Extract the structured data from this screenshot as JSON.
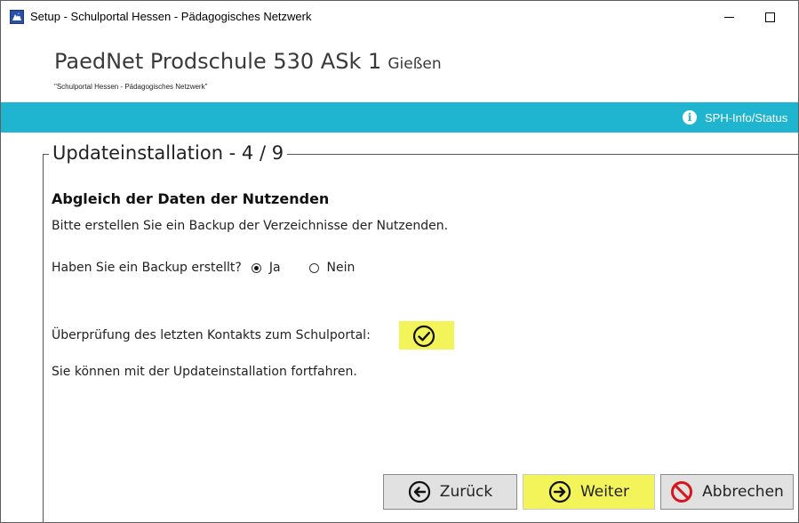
{
  "window": {
    "title": "Setup - Schulportal Hessen - Pädagogisches Netzwerk",
    "minimize_icon": "minimize-icon",
    "maximize_icon": "maximize-icon"
  },
  "header": {
    "title": "PaedNet Prodschule 530 ASk 1",
    "location": "Gießen",
    "subtitle": "\"Schulportal Hessen - Pädagogisches Netzwerk\""
  },
  "infobar": {
    "link_label": "SPH-Info/Status",
    "icon": "info-icon",
    "color": "#1fb5d0"
  },
  "step": {
    "title": "Updateinstallation - 4 / 9",
    "heading": "Abgleich der Daten der Nutzenden",
    "description": "Bitte erstellen Sie ein Backup der Verzeichnisse der Nutzenden.",
    "backup_question": "Haben Sie ein Backup erstellt?",
    "options": [
      {
        "label": "Ja",
        "selected": true
      },
      {
        "label": "Nein",
        "selected": false
      }
    ],
    "contact_check_label": "Überprüfung des letzten Kontakts zum Schulportal:",
    "contact_check_status": "check-circle-icon",
    "continue_message": "Sie können mit der Updateinstallation fortfahren."
  },
  "buttons": {
    "back_label": "Zurück",
    "next_label": "Weiter",
    "cancel_label": "Abbrechen"
  },
  "colors": {
    "highlight": "#f3f45a",
    "cancel_red": "#d6161c",
    "button_bg": "#e1e1e1"
  }
}
